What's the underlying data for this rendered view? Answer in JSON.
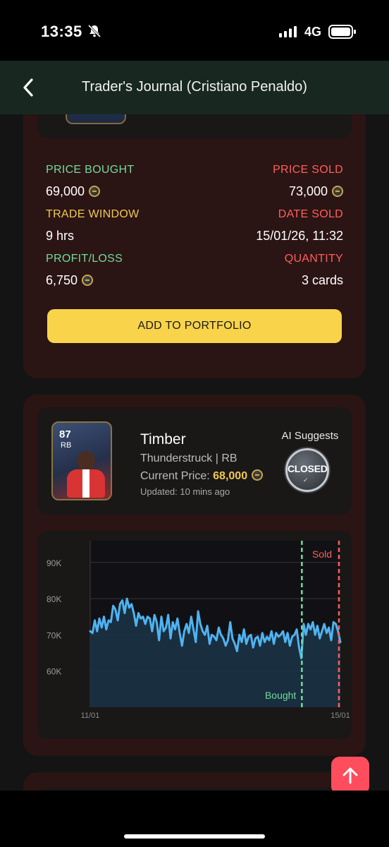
{
  "status_bar": {
    "time": "13:35",
    "network": "4G"
  },
  "nav": {
    "title": "Trader's Journal (Cristiano Penaldo)"
  },
  "trade": {
    "price_bought_label": "PRICE BOUGHT",
    "price_bought_value": "69,000",
    "price_sold_label": "PRICE SOLD",
    "price_sold_value": "73,000",
    "trade_window_label": "TRADE WINDOW",
    "trade_window_value": "9 hrs",
    "date_sold_label": "DATE SOLD",
    "date_sold_value": "15/01/26, 11:32",
    "profit_label": "PROFIT/LOSS",
    "profit_value": "6,750",
    "quantity_label": "QUANTITY",
    "quantity_value": "3 cards",
    "add_button": "ADD TO PORTFOLIO"
  },
  "player": {
    "name": "Timber",
    "rating": "87",
    "position": "RB",
    "version": "Thunderstruck | RB",
    "price_label": "Current Price:",
    "price_value": "68,000",
    "updated": "Updated: 10 mins ago",
    "ai_label": "AI Suggests",
    "ai_badge": "CLOSED"
  },
  "colors": {
    "green": "#6fdd9a",
    "red": "#ff5f5a",
    "yellow": "#f1c94d",
    "line": "#4fb3f0",
    "card_bg": "#2b1414"
  },
  "chart_data": {
    "type": "line",
    "title": "",
    "xlabel": "",
    "ylabel": "",
    "x_tick_labels": [
      "11/01",
      "15/01"
    ],
    "y_tick_labels": [
      "90K",
      "80K",
      "70K",
      "60K"
    ],
    "ylim": [
      50000,
      96000
    ],
    "grid": true,
    "bought_label": "Bought",
    "sold_label": "Sold",
    "bought_x": 0.846,
    "sold_x": 1.0,
    "series": [
      {
        "values": [
          71000,
          70500,
          74000,
          71000,
          74500,
          72000,
          75000,
          71500,
          74000,
          73500,
          78000,
          77000,
          74000,
          78500,
          79500,
          76000,
          80000,
          77500,
          78500,
          76000,
          72500,
          76000,
          74500,
          75000,
          73000,
          75000,
          74500,
          71000,
          75500,
          73500,
          68500,
          75000,
          71000,
          72000,
          75500,
          69000,
          73500,
          71500,
          74500,
          70500,
          67000,
          71000,
          73000,
          70500,
          75000,
          71500,
          68000,
          76500,
          73000,
          71000,
          70000,
          72500,
          67500,
          70000,
          69500,
          68500,
          72000,
          70000,
          69000,
          67000,
          68500,
          73500,
          69000,
          67500,
          65500,
          70000,
          68000,
          71500,
          67500,
          69500,
          70000,
          66500,
          69000,
          69500,
          67000,
          70500,
          68000,
          69500,
          68500,
          71000,
          67500,
          70500,
          69500,
          70000,
          71000,
          68000,
          70500,
          67000,
          69500,
          70000,
          71500,
          66500,
          63500,
          73000,
          70000,
          73000,
          71500,
          73500,
          70000,
          72500,
          69000,
          71000,
          73000,
          70500,
          72000,
          68500,
          73500,
          73000,
          71000,
          68000
        ]
      }
    ]
  }
}
